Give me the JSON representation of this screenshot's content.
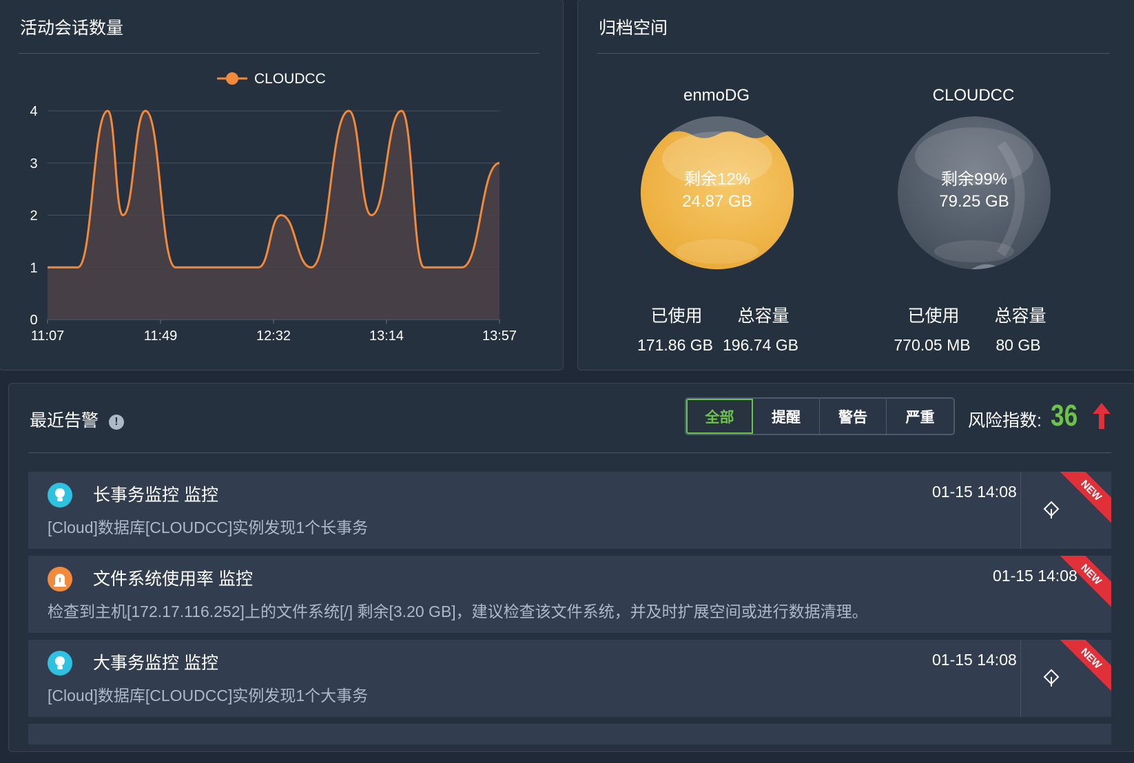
{
  "sessions": {
    "title": "活动会话数量",
    "legend_label": "CLOUDCC"
  },
  "chart_data": {
    "type": "area",
    "title": "活动会话数量",
    "series": [
      {
        "name": "CLOUDCC",
        "points": [
          [
            0,
            1
          ],
          [
            2,
            1
          ],
          [
            4,
            1
          ],
          [
            8,
            4
          ],
          [
            10,
            2
          ],
          [
            13,
            4
          ],
          [
            17,
            1
          ],
          [
            22,
            1
          ],
          [
            25,
            1
          ],
          [
            28,
            1
          ],
          [
            31,
            2
          ],
          [
            35,
            1
          ],
          [
            40,
            4
          ],
          [
            43,
            2
          ],
          [
            47,
            4
          ],
          [
            50,
            1
          ],
          [
            52,
            1
          ],
          [
            55,
            1
          ],
          [
            60,
            3
          ]
        ],
        "color": "#f28a3c"
      }
    ],
    "x_ticks": [
      {
        "pos": 0,
        "label": "11:07"
      },
      {
        "pos": 15,
        "label": "11:49"
      },
      {
        "pos": 30,
        "label": "12:32"
      },
      {
        "pos": 45,
        "label": "13:14"
      },
      {
        "pos": 60,
        "label": "13:57"
      }
    ],
    "xlim": [
      0,
      60
    ],
    "ylim": [
      0,
      4
    ],
    "y_ticks": [
      0,
      1,
      2,
      3,
      4
    ],
    "legend": "top-center",
    "grid": true
  },
  "archive": {
    "title": "归档空间",
    "dbs": [
      {
        "name": "enmoDG",
        "remaining_pct": "剩余12%",
        "remaining_size": "24.87 GB",
        "used_label": "已使用",
        "total_label": "总容量",
        "used": "171.86 GB",
        "total": "196.74 GB",
        "fill_fraction": 0.88,
        "color": "#f0b444"
      },
      {
        "name": "CLOUDCC",
        "remaining_pct": "剩余99%",
        "remaining_size": "79.25 GB",
        "used_label": "已使用",
        "total_label": "总容量",
        "used": "770.05 MB",
        "total": "80 GB",
        "fill_fraction": 0.01,
        "color": "#5b6574"
      }
    ]
  },
  "alerts": {
    "title": "最近告警",
    "filters": [
      "全部",
      "提醒",
      "警告",
      "严重"
    ],
    "active_filter": "全部",
    "risk_label": "风险指数:",
    "risk_value": "36",
    "risk_color": "#6cc24a",
    "trend_color": "#e0303a",
    "items": [
      {
        "icon": "lightbulb-icon",
        "icon_color": "#2ec2e0",
        "title": "长事务监控 监控",
        "desc": "[Cloud]数据库[CLOUDCC]实例发现1个长事务",
        "time": "01-15 14:08",
        "badge": "NEW"
      },
      {
        "icon": "alarm-icon",
        "icon_color": "#f28a3c",
        "title": "文件系统使用率 监控",
        "desc": "检查到主机[172.17.116.252]上的文件系统[/] 剩余[3.20 GB]，建议检查该文件系统，并及时扩展空间或进行数据清理。",
        "time": "01-15 14:08",
        "badge": "NEW"
      },
      {
        "icon": "lightbulb-icon",
        "icon_color": "#2ec2e0",
        "title": "大事务监控 监控",
        "desc": "[Cloud]数据库[CLOUDCC]实例发现1个大事务",
        "time": "01-15 14:08",
        "badge": "NEW"
      }
    ]
  }
}
